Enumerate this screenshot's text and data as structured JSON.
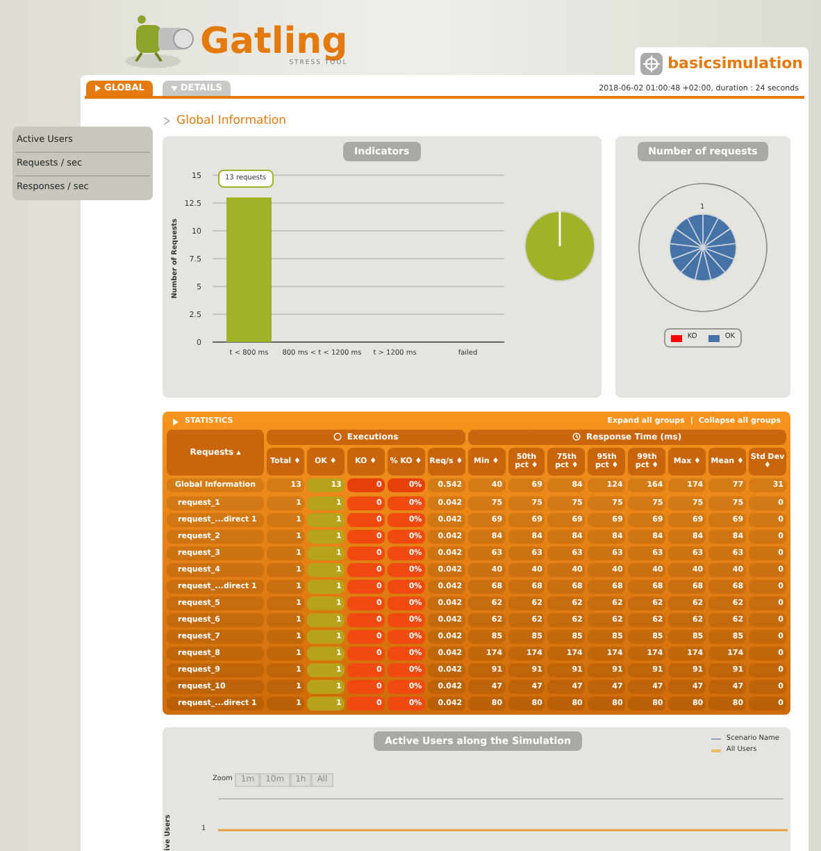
{
  "logo": {
    "name": "Gatling",
    "tagline": "STRESS TOOL"
  },
  "simulation": {
    "name": "basicsimulation"
  },
  "tabs": [
    {
      "label": "GLOBAL",
      "selected": true
    },
    {
      "label": "DETAILS",
      "selected": false
    }
  ],
  "run_info": "2018-06-02 01:00:48 +02:00, duration : 24 seconds",
  "sidebar": {
    "items": [
      {
        "label": "Active Users",
        "selected": false
      },
      {
        "label": "Requests / sec",
        "selected": false
      },
      {
        "label": "Responses / sec",
        "selected": false
      }
    ]
  },
  "section_title": "Global Information",
  "indicators": {
    "title": "Indicators",
    "tooltip": "13 requests",
    "chart_data": {
      "type": "bar",
      "ylabel": "Number of Requests",
      "categories": [
        "t < 800 ms",
        "800 ms < t < 1200 ms",
        "t > 1200 ms",
        "failed"
      ],
      "values": [
        13,
        0,
        0,
        0
      ],
      "grid": true,
      "ylim": [
        0,
        15
      ],
      "yticks": [
        0,
        2.5,
        5,
        7.5,
        10,
        12.5,
        15
      ]
    }
  },
  "requests_chart": {
    "title": "Number of requests",
    "label": "1",
    "legend": [
      {
        "label": "KO",
        "color": "#ff0000"
      },
      {
        "label": "OK",
        "color": "#4572a7"
      }
    ]
  },
  "statistics": {
    "title": "STATISTICS",
    "expand": "Expand all groups",
    "separator": "|",
    "collapse": "Collapse all groups",
    "groups": [
      "Executions",
      "Response Time (ms)"
    ],
    "columns": [
      "Requests ▴",
      "Total ♦",
      "OK ♦",
      "KO ♦",
      "% KO ♦",
      "Req/s ♦",
      "Min ♦",
      "50th pct ♦",
      "75th pct ♦",
      "95th pct ♦",
      "99th pct ♦",
      "Max ♦",
      "Mean ♦",
      "Std Dev ♦"
    ],
    "global": [
      "Global Information",
      "13",
      "13",
      "0",
      "0%",
      "0.542",
      "40",
      "69",
      "84",
      "124",
      "164",
      "174",
      "77",
      "31"
    ],
    "rows": [
      [
        "request_1",
        "1",
        "1",
        "0",
        "0%",
        "0.042",
        "75",
        "75",
        "75",
        "75",
        "75",
        "75",
        "75",
        "0"
      ],
      [
        "request_...direct 1",
        "1",
        "1",
        "0",
        "0%",
        "0.042",
        "69",
        "69",
        "69",
        "69",
        "69",
        "69",
        "69",
        "0"
      ],
      [
        "request_2",
        "1",
        "1",
        "0",
        "0%",
        "0.042",
        "84",
        "84",
        "84",
        "84",
        "84",
        "84",
        "84",
        "0"
      ],
      [
        "request_3",
        "1",
        "1",
        "0",
        "0%",
        "0.042",
        "63",
        "63",
        "63",
        "63",
        "63",
        "63",
        "63",
        "0"
      ],
      [
        "request_4",
        "1",
        "1",
        "0",
        "0%",
        "0.042",
        "40",
        "40",
        "40",
        "40",
        "40",
        "40",
        "40",
        "0"
      ],
      [
        "request_...direct 1",
        "1",
        "1",
        "0",
        "0%",
        "0.042",
        "68",
        "68",
        "68",
        "68",
        "68",
        "68",
        "68",
        "0"
      ],
      [
        "request_5",
        "1",
        "1",
        "0",
        "0%",
        "0.042",
        "62",
        "62",
        "62",
        "62",
        "62",
        "62",
        "62",
        "0"
      ],
      [
        "request_6",
        "1",
        "1",
        "0",
        "0%",
        "0.042",
        "62",
        "62",
        "62",
        "62",
        "62",
        "62",
        "62",
        "0"
      ],
      [
        "request_7",
        "1",
        "1",
        "0",
        "0%",
        "0.042",
        "85",
        "85",
        "85",
        "85",
        "85",
        "85",
        "85",
        "0"
      ],
      [
        "request_8",
        "1",
        "1",
        "0",
        "0%",
        "0.042",
        "174",
        "174",
        "174",
        "174",
        "174",
        "174",
        "174",
        "0"
      ],
      [
        "request_9",
        "1",
        "1",
        "0",
        "0%",
        "0.042",
        "91",
        "91",
        "91",
        "91",
        "91",
        "91",
        "91",
        "0"
      ],
      [
        "request_10",
        "1",
        "1",
        "0",
        "0%",
        "0.042",
        "47",
        "47",
        "47",
        "47",
        "47",
        "47",
        "47",
        "0"
      ],
      [
        "request_...direct 1",
        "1",
        "1",
        "0",
        "0%",
        "0.042",
        "80",
        "80",
        "80",
        "80",
        "80",
        "80",
        "80",
        "0"
      ]
    ]
  },
  "active_users": {
    "title": "Active Users along the Simulation",
    "zoom_label": "Zoom",
    "zoom_buttons": [
      "1m",
      "10m",
      "1h",
      "All"
    ],
    "ylabel": "ive Users",
    "ytick": "1",
    "legend": [
      {
        "label": "Scenario Name",
        "color": "#90a4c0"
      },
      {
        "label": "All Users",
        "color": "#f0b860"
      }
    ]
  }
}
